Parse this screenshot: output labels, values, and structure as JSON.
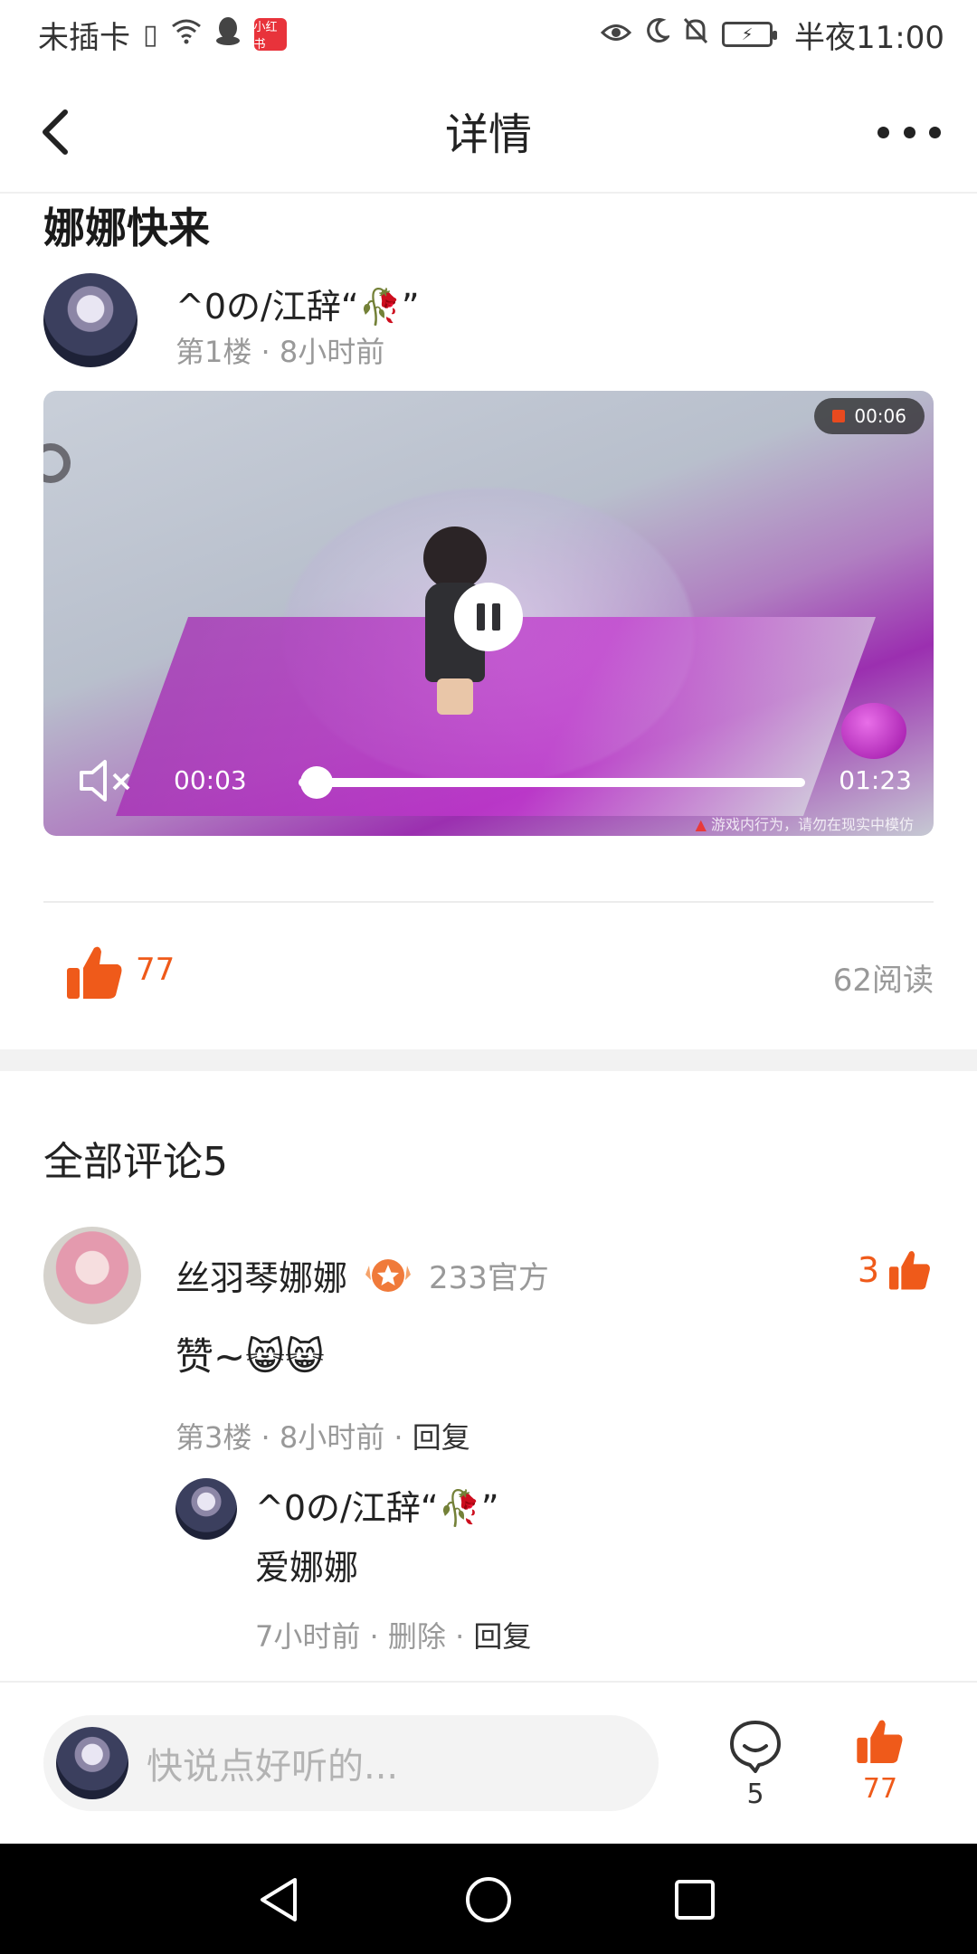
{
  "status_bar": {
    "carrier": "未插卡",
    "app_badge": "小红书",
    "battery_symbol": "⚡",
    "time": "半夜11:00"
  },
  "header": {
    "title": "详情"
  },
  "post": {
    "title": "娜娜快来",
    "author": "^0の/江辞“🥀”",
    "meta": "第1楼 · 8小时前"
  },
  "video": {
    "record_time": "00:06",
    "current_time": "00:03",
    "total_time": "01:23",
    "progress": 0.036,
    "warning": "游戏内行为，请勿在现实中模仿"
  },
  "stats": {
    "likes": "77",
    "reads": "62阅读"
  },
  "comments": {
    "title": "全部评论5",
    "items": [
      {
        "name": "丝羽琴娜娜",
        "badge": "233官方",
        "likes": "3",
        "text": "赞~😸😸",
        "floor_time": "第3楼 · 8小时前 · ",
        "reply_action": "回复",
        "reply": {
          "name": "^0の/江辞“🥀”",
          "text": "爱娜娜",
          "time": "7小时前 · ",
          "delete_action": "删除",
          "reply_action": "回复"
        }
      }
    ]
  },
  "bottom_bar": {
    "placeholder": "快说点好听的...",
    "comment_count": "5",
    "like_count": "77"
  },
  "colors": {
    "accent": "#ef5a1a",
    "muted": "#999999"
  }
}
